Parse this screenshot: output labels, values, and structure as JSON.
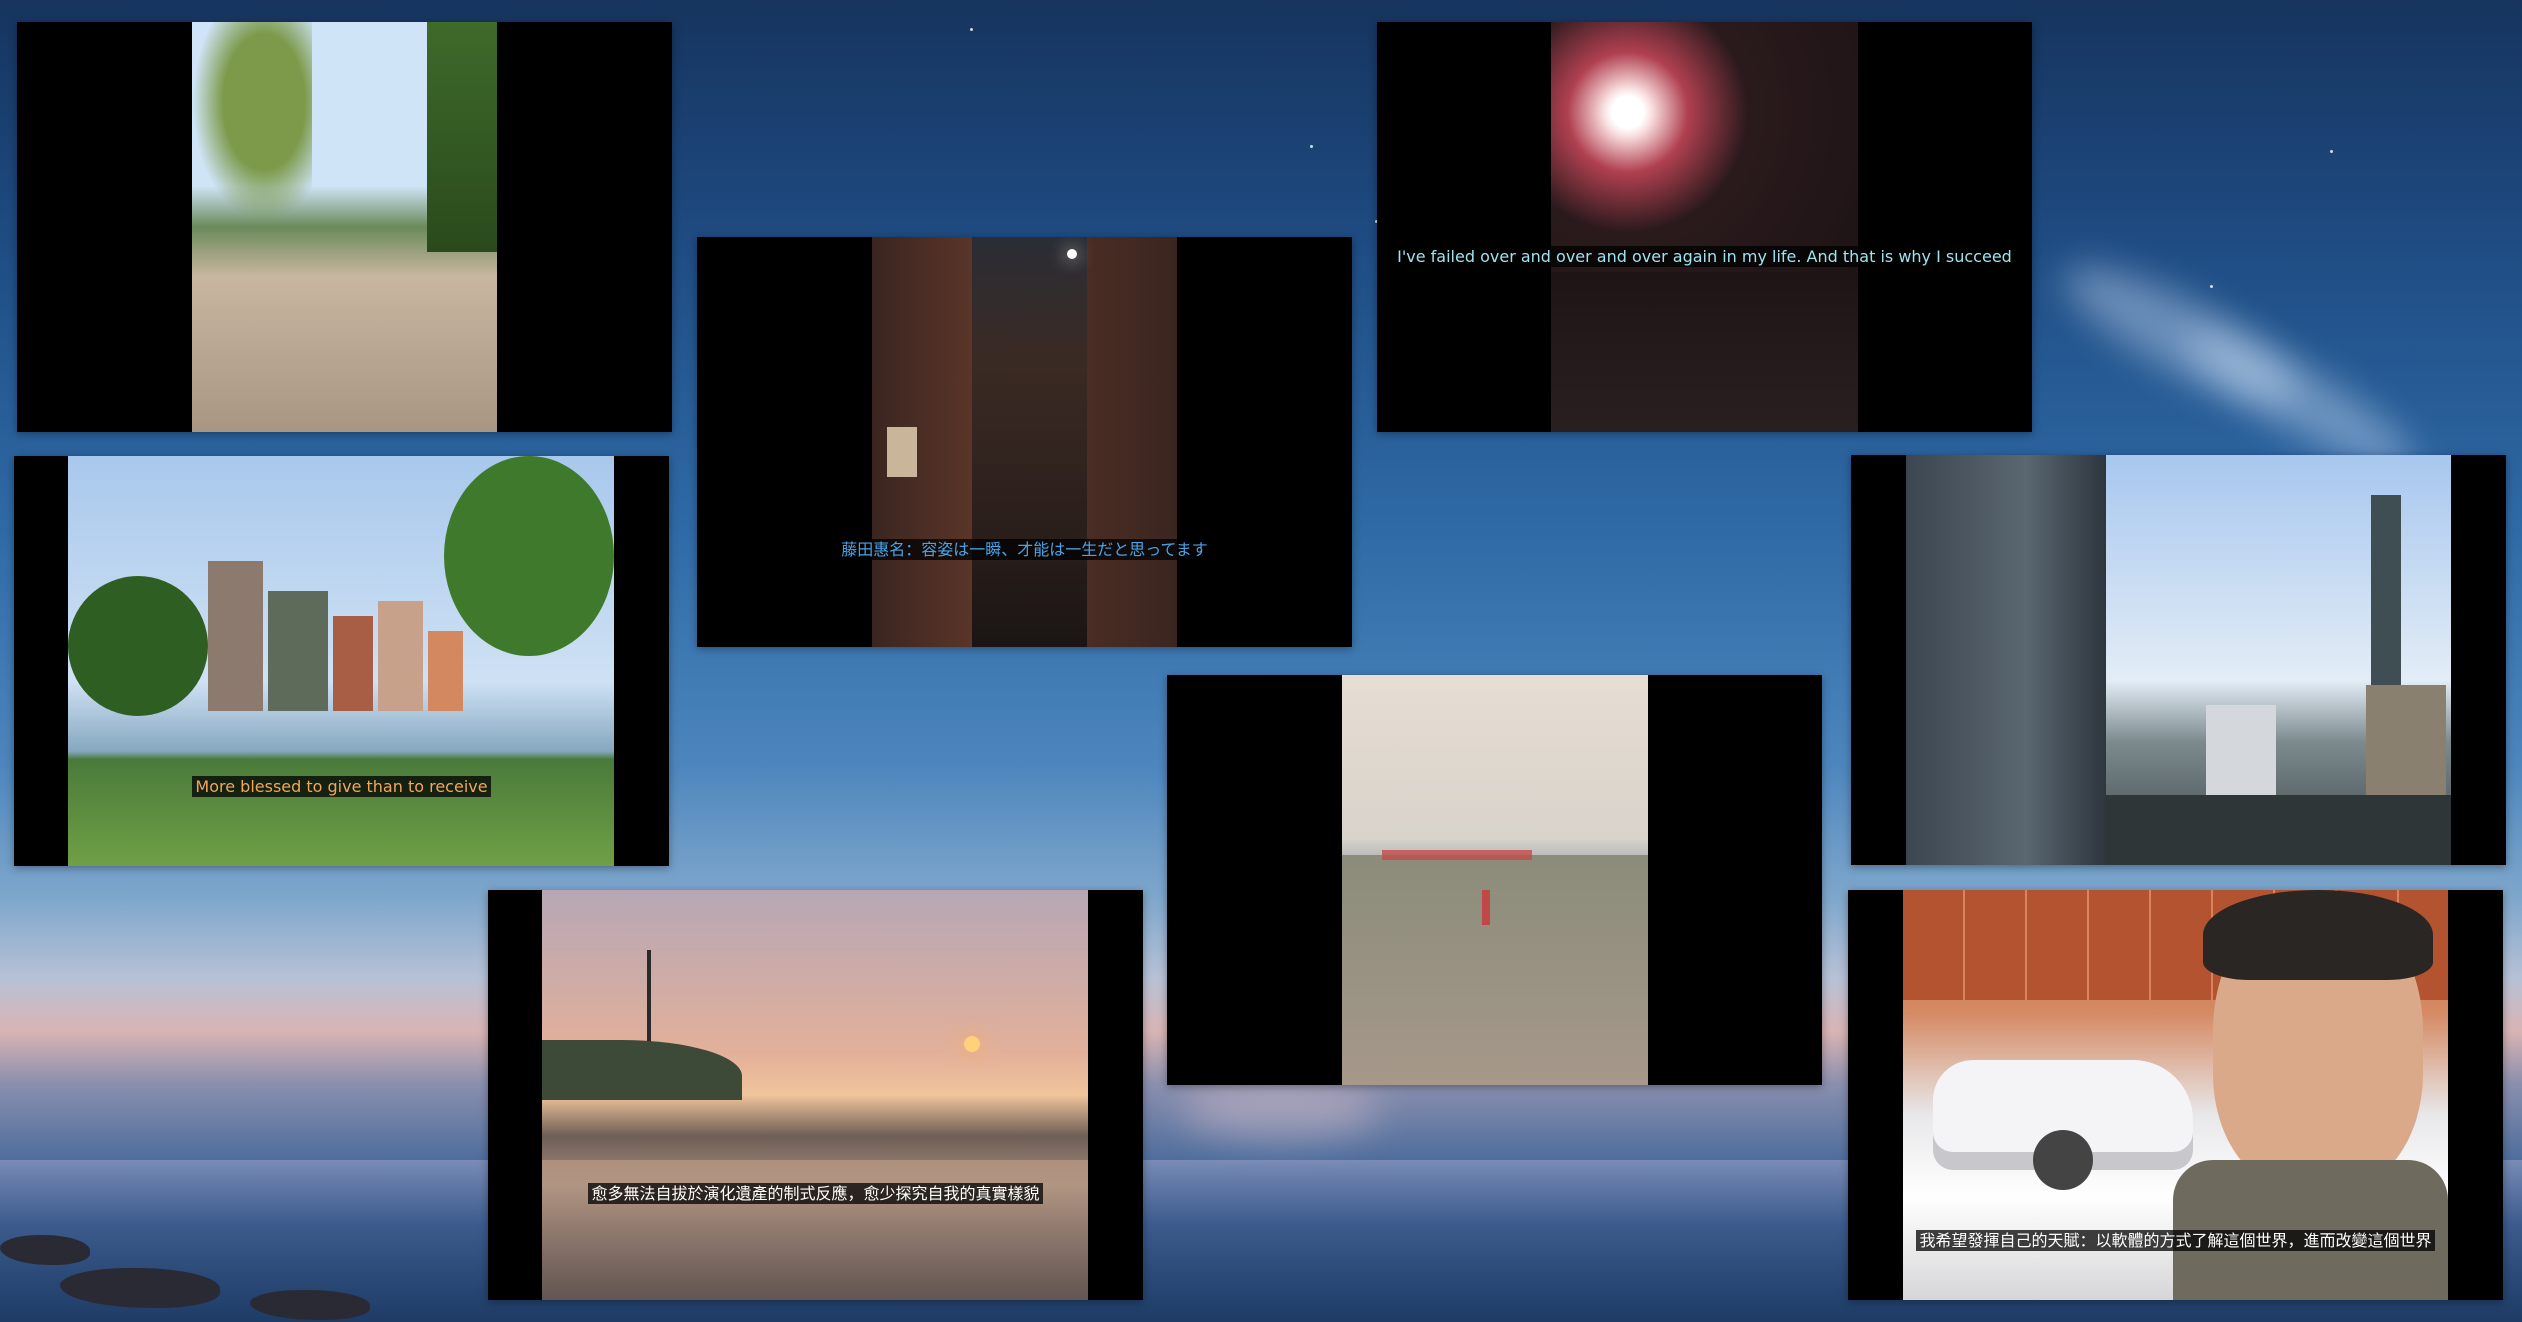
{
  "screensaver": {
    "tiles": [
      {
        "name": "willow-path-photo",
        "caption": ""
      },
      {
        "name": "brick-alley-photo",
        "caption": "藤田惠名：容姿は一瞬、才能は一生だと思ってます"
      },
      {
        "name": "night-street-photo",
        "caption": "I've failed over and over and over again in my life. And that is why I succeed"
      },
      {
        "name": "park-skyline-photo",
        "caption": "More blessed to give than to receive"
      },
      {
        "name": "taipei101-photo",
        "caption": ""
      },
      {
        "name": "beach-path-photo",
        "caption": ""
      },
      {
        "name": "windmill-sunset-photo",
        "caption": "愈多無法自拔於演化遺產的制式反應，愈少探究自我的真實樣貌"
      },
      {
        "name": "car-show-selfie-photo",
        "caption": "我希望發揮自己的天賦：以軟體的方式了解這個世界，進而改變這個世界"
      }
    ],
    "colors": {
      "caption_orange": "#f2a65a",
      "caption_blue": "#4aa3e8",
      "caption_cyan": "#9ee3f0",
      "caption_white": "#ffffff"
    }
  }
}
